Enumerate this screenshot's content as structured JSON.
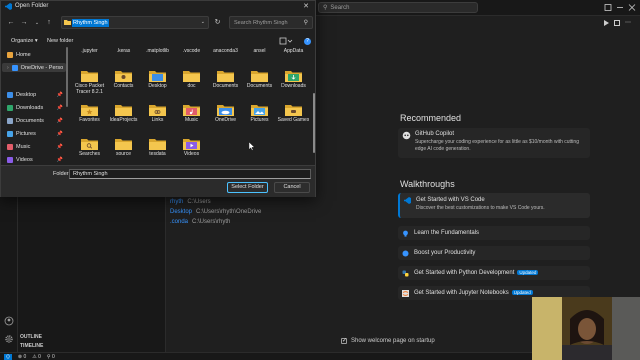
{
  "vscode": {
    "search_placeholder": "Search",
    "recent": [
      {
        "name": "rhyth",
        "path": "C:\\Users"
      },
      {
        "name": "Desktop",
        "path": "C:\\Users\\rhyth\\OneDrive"
      },
      {
        "name": ".conda",
        "path": "C:\\Users\\rhyth"
      }
    ],
    "recommended_title": "Recommended",
    "copilot": {
      "title": "GitHub Copilot",
      "desc": "Supercharge your coding experience for as little as $10/month with cutting edge AI code generation."
    },
    "walkthroughs_title": "Walkthroughs",
    "walkthroughs": [
      {
        "title": "Get Started with VS Code",
        "desc": "Discover the best customizations to make VS Code yours.",
        "badge": ""
      },
      {
        "title": "Learn the Fundamentals",
        "desc": "",
        "badge": ""
      },
      {
        "title": "Boost your Productivity",
        "desc": "",
        "badge": ""
      },
      {
        "title": "Get Started with Python Development",
        "desc": "",
        "badge": "Updated"
      },
      {
        "title": "Get Started with Jupyter Notebooks",
        "desc": "",
        "badge": "Updated"
      }
    ],
    "show_welcome": "Show welcome page on startup",
    "outline": "OUTLINE",
    "timeline": "TIMELINE",
    "status": {
      "errors": "⊗ 0",
      "warnings": "⚠ 0",
      "ports": "⚲ 0"
    }
  },
  "dialog": {
    "title": "Open Folder",
    "address": "Rhythm Singh",
    "search_placeholder": "Search Rhythm Singh",
    "organize": "Organize ▾",
    "new_folder": "New folder",
    "nav_items": [
      {
        "label": "Home",
        "color": "#e8a33d",
        "pin": false
      },
      {
        "label": "OneDrive - Perso",
        "color": "#3794ff",
        "pin": false
      },
      {
        "label": "Desktop",
        "color": "#3c8ee8",
        "pin": true
      },
      {
        "label": "Downloads",
        "color": "#2fa66b",
        "pin": true
      },
      {
        "label": "Documents",
        "color": "#8aa5c8",
        "pin": true
      },
      {
        "label": "Pictures",
        "color": "#47a3e8",
        "pin": true
      },
      {
        "label": "Music",
        "color": "#e35d6a",
        "pin": true
      },
      {
        "label": "Videos",
        "color": "#8a5ce8",
        "pin": true
      }
    ],
    "top_row": [
      ".jupyter",
      ".keras",
      ".matplotlib",
      ".vscode",
      "anaconda3",
      "ansel",
      "AppData"
    ],
    "grid": [
      [
        {
          "label": "Cisco Packet Tracer 8.2.1",
          "kind": "plain"
        },
        {
          "label": "Contacts",
          "kind": "contacts"
        },
        {
          "label": "Desktop",
          "kind": "desktop"
        },
        {
          "label": "doc",
          "kind": "plain"
        },
        {
          "label": "Documents",
          "kind": "plain"
        },
        {
          "label": "Documents",
          "kind": "plain"
        },
        {
          "label": "Downloads",
          "kind": "downloads"
        }
      ],
      [
        {
          "label": "Favorites",
          "kind": "favorites"
        },
        {
          "label": "IdeaProjects",
          "kind": "plain"
        },
        {
          "label": "Links",
          "kind": "links"
        },
        {
          "label": "Music",
          "kind": "music"
        },
        {
          "label": "OneDrive",
          "kind": "onedrive"
        },
        {
          "label": "Pictures",
          "kind": "pictures"
        },
        {
          "label": "Saved Games",
          "kind": "saved"
        }
      ],
      [
        {
          "label": "Searches",
          "kind": "searches"
        },
        {
          "label": "source",
          "kind": "plain"
        },
        {
          "label": "tesdata",
          "kind": "plain"
        },
        {
          "label": "Videos",
          "kind": "videos"
        }
      ]
    ],
    "folder_label": "Folder:",
    "folder_value": "Rhythm Singh",
    "select_button": "Select Folder",
    "cancel_button": "Cancel"
  }
}
